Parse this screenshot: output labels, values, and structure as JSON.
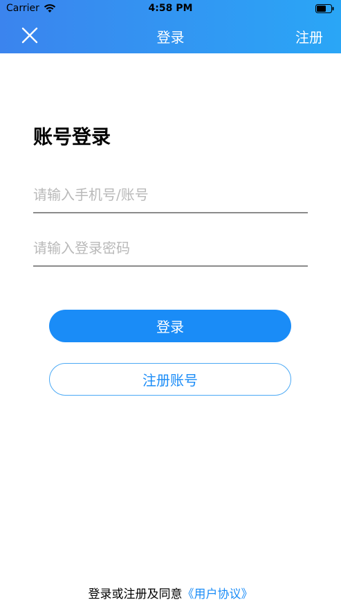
{
  "status_bar": {
    "carrier": "Carrier",
    "time": "4:58 PM"
  },
  "nav": {
    "title": "登录",
    "register": "注册",
    "close_icon": "close-icon"
  },
  "login": {
    "heading": "账号登录",
    "account_placeholder": "请输入手机号/账号",
    "password_placeholder": "请输入登录密码",
    "login_button": "登录",
    "register_button": "注册账号"
  },
  "footer": {
    "agreement_text": "登录或注册及同意",
    "agreement_link": "《用户协议》"
  },
  "colors": {
    "header_gradient_start": "#3b84ee",
    "header_gradient_end": "#2aa6f6",
    "primary": "#1a8cf7"
  }
}
